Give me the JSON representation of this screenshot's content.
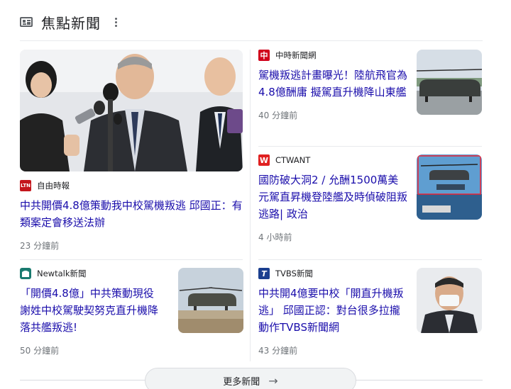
{
  "header": {
    "title": "焦點新聞"
  },
  "featured": {
    "source": "自由時報",
    "source_logo": "LTN",
    "headline": "中共開價4.8億策動我中校駕機叛逃 邱國正：有類案定會移送法辦",
    "time": "23 分鐘前"
  },
  "left_bottom": {
    "source": "Newtalk新聞",
    "headline": "「開價4.8億」中共策動現役謝姓中校駕駛契努克直升機降落共艦叛逃!",
    "time": "50 分鐘前"
  },
  "right_items": [
    {
      "source": "中時新聞網",
      "source_logo": "中",
      "headline": "駕機叛逃計畫曝光！陸航飛官為4.8億酬庸 擬駕直升機降山東艦",
      "time": "40 分鐘前"
    },
    {
      "source": "CTWANT",
      "source_logo": "W",
      "headline": "國防破大洞2 / 允酬1500萬美元駕直昇機登陸艦及時偵破阻叛逃路| 政治",
      "time": "4 小時前"
    },
    {
      "source": "TVBS新聞",
      "source_logo": "T",
      "headline": "中共開4億要中校「開直升機叛逃」 邱國正認：對台很多拉攏動作TVBS新聞網",
      "time": "43 分鐘前"
    }
  ],
  "more_news_label": "更多新聞",
  "colors": {
    "link": "#1a0dab",
    "ltn": "#c4161c",
    "chinatimes": "#d0021b",
    "ctwant": "#e02020",
    "newtalk": "#1a7a6f",
    "tvbs": "#1b3f8f"
  }
}
